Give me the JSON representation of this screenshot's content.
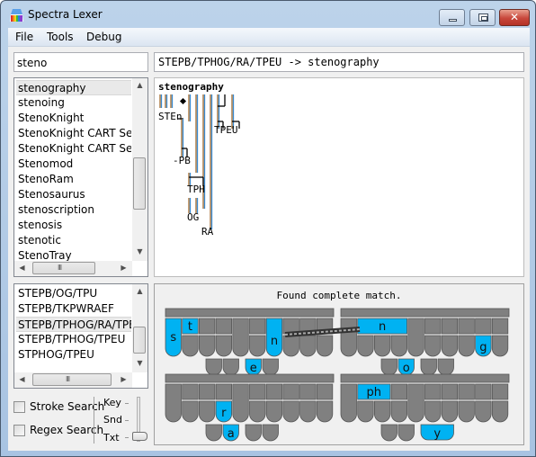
{
  "window": {
    "title": "Spectra Lexer",
    "controls": {
      "minimize": "minimize",
      "maximize": "maximize",
      "close": "close"
    }
  },
  "menu": [
    "File",
    "Tools",
    "Debug"
  ],
  "search": {
    "value": "steno",
    "placeholder": ""
  },
  "rules_field": {
    "value": "STEPB/TPHOG/RA/TPEU -> stenography"
  },
  "word_list": {
    "items": [
      "stenography",
      "stenoing",
      "StenoKnight",
      "StenoKnight CART Servi",
      "StenoKnight CART Servi",
      "Stenomod",
      "StenoRam",
      "Stenosaurus",
      "stenoscription",
      "stenosis",
      "stenotic",
      "StenoTray"
    ],
    "selected": "stenography"
  },
  "stroke_list": {
    "items": [
      "STEPB/OG/TPU",
      "STEPB/TKPWRAEF",
      "STEPB/TPHOG/RA/TPEU",
      "STEPB/TPHOG/TPEU",
      "STPHOG/TPEU"
    ],
    "selected": "STEPB/TPHOG/RA/TPEU"
  },
  "graph": {
    "word": "stenography",
    "nodes": [
      "STEn",
      "TPEU",
      "-PB",
      "TPH",
      "OG",
      "RA"
    ]
  },
  "board": {
    "caption": "Found complete match.",
    "highlight_color": "#00b2f2",
    "key_color": "#808080",
    "strokes": [
      {
        "label": "stroke-1",
        "keys": [
          "s",
          "t",
          "n",
          "e",
          "n",
          "o",
          "g"
        ]
      },
      {
        "label": "stroke-2",
        "keys": [
          "r",
          "a",
          "ph",
          "y"
        ]
      }
    ]
  },
  "options": {
    "stroke_search": {
      "label": "Stroke Search",
      "checked": false
    },
    "regex_search": {
      "label": "Regex Search",
      "checked": false
    }
  },
  "display_mode": {
    "levels": [
      "Key",
      "Snd",
      "Txt"
    ],
    "selected": "Txt"
  },
  "scrollbar_grip": "III"
}
